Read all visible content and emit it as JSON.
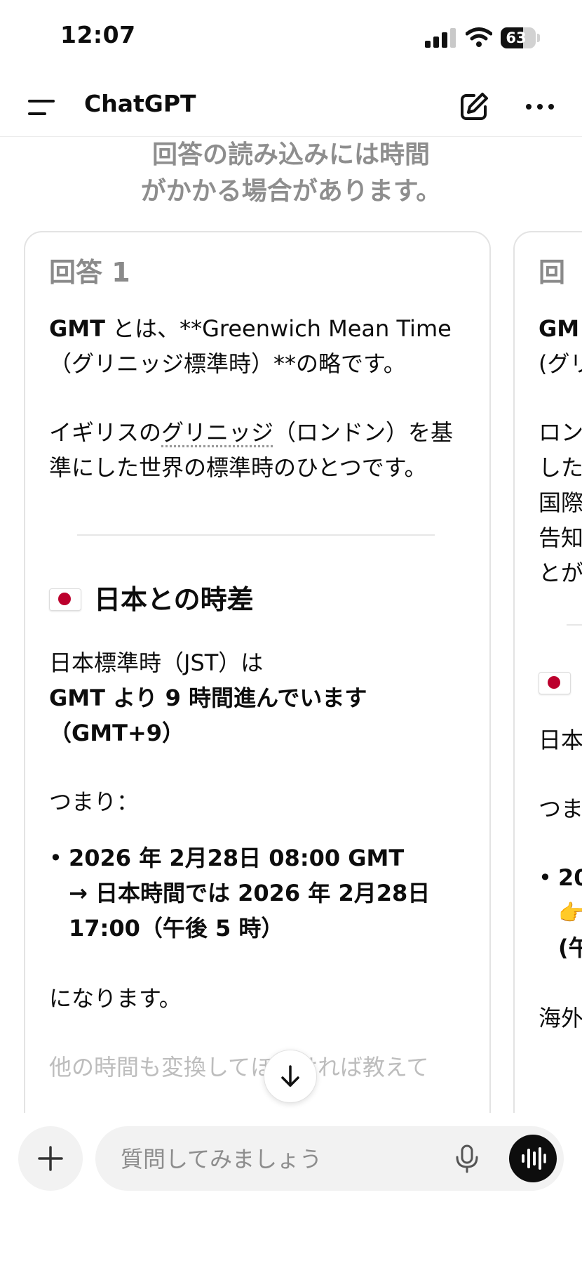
{
  "status_bar": {
    "time": "12:07",
    "battery_level": "63",
    "signal_bars": 3,
    "signal_bars_max": 4,
    "icons": [
      "cellular-signal-icon",
      "wifi-icon",
      "battery-icon"
    ]
  },
  "header": {
    "title": "ChatGPT",
    "icons": [
      "menu-icon",
      "new-chat-icon",
      "more-options-icon"
    ]
  },
  "loading_note": {
    "line1": "回答の読み込みには時間",
    "line2": "がかかる場合があります。"
  },
  "response_1": {
    "label": "回答 1",
    "intro_bold": "GMT",
    "intro_rest": " とは、**Greenwich Mean Time（グリニッジ標準時）**の略です。",
    "sentence_start": "イギリスの",
    "sentence_term": "グリニッジ",
    "sentence_end": "（ロンドン）を基準にした世界の標準時のひとつです。",
    "section_title": "日本との時差",
    "jst_line": "日本標準時（JST）は",
    "jst_bold": "GMT より 9 時間進んでいます（GMT+9）",
    "tsumari": "つまり：",
    "bullet_line1": "2026 年 2月28日 08:00 GMT",
    "bullet_line2": "→ 日本時間では 2026 年 2月28日 17:00（午後 5 時）",
    "closing": "になります。",
    "followup": "他の時間も変換してほしければ教えて"
  },
  "response_2": {
    "label": "回",
    "line_a": "GM",
    "line_b": "(グリ",
    "p2_lines": [
      "ロン",
      "した",
      "国際",
      "告知",
      "とが"
    ],
    "jp_line": "日本",
    "tsumari": "つま",
    "bullet_a": "20",
    "bullet_b": "👉",
    "bullet_c": "(午",
    "tail": "海外"
  },
  "composer": {
    "placeholder": "質問してみましょう",
    "icons": [
      "plus-icon",
      "microphone-icon",
      "voice-mode-icon",
      "scroll-down-arrow-icon"
    ]
  },
  "colors": {
    "text": "#0d0d0d",
    "muted": "#8e8e8e",
    "card_border": "#e3e3e3",
    "input_bg": "#f2f2f2",
    "flag_red": "#bc002d"
  }
}
